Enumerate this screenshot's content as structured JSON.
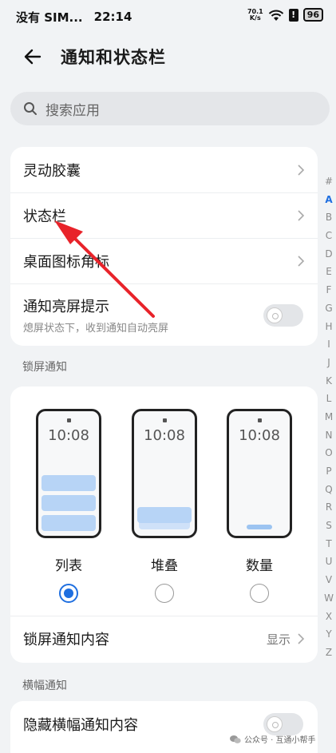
{
  "status_bar": {
    "carrier": "没有 SIM...",
    "time": "22:14",
    "speed_value": "70.1",
    "speed_unit": "K/s",
    "alert": "!",
    "battery": "96"
  },
  "header": {
    "title": "通知和状态栏"
  },
  "search": {
    "placeholder": "搜索应用"
  },
  "menu_card": {
    "items": [
      {
        "label": "灵动胶囊"
      },
      {
        "label": "状态栏"
      },
      {
        "label": "桌面图标角标"
      },
      {
        "label": "通知亮屏提示",
        "sublabel": "熄屏状态下，收到通知自动亮屏",
        "toggle_on": false
      }
    ]
  },
  "lockscreen": {
    "section_title": "锁屏通知",
    "phone_time": "10:08",
    "styles": [
      {
        "label": "列表",
        "selected": true
      },
      {
        "label": "堆叠",
        "selected": false
      },
      {
        "label": "数量",
        "selected": false
      }
    ],
    "content_row": {
      "label": "锁屏通知内容",
      "value": "显示"
    }
  },
  "banner": {
    "section_title": "横幅通知",
    "hide_row": {
      "label": "隐藏横幅通知内容",
      "toggle_on": false
    }
  },
  "index_bar": [
    "#",
    "A",
    "B",
    "C",
    "D",
    "E",
    "F",
    "G",
    "H",
    "I",
    "J",
    "K",
    "L",
    "M",
    "N",
    "O",
    "P",
    "Q",
    "R",
    "S",
    "T",
    "U",
    "V",
    "W",
    "X",
    "Y",
    "Z"
  ],
  "index_active": "A",
  "watermark": "公众号 · 互通小帮手",
  "colors": {
    "accent": "#1f6fe0",
    "annotation_arrow": "#e8232a",
    "notification_preview": "#b7d4f6"
  }
}
